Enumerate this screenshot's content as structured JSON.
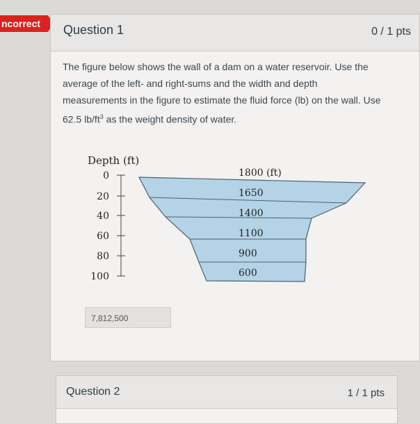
{
  "status_badge": "ncorrect",
  "question1": {
    "title": "Question 1",
    "points": "0 / 1 pts",
    "text_line1": "The figure below shows the wall of a dam on a water reservoir. Use the",
    "text_line2": "average of the left- and right-sums and the width and depth",
    "text_line3": "measurements in the figure to estimate the fluid force (lb) on the wall. Use",
    "text_line4_pre": "62.5 lb/ft",
    "text_line4_sup": "3",
    "text_line4_post": " as the weight density of water.",
    "answer": "7,812,500"
  },
  "figure": {
    "depth_label": "Depth (ft)",
    "depth_ticks": [
      "0",
      "20",
      "40",
      "60",
      "80",
      "100"
    ],
    "width_labels": [
      "1800 (ft)",
      "1650",
      "1400",
      "1100",
      "900",
      "600"
    ],
    "water_fill": "#b5d3e6",
    "water_stroke": "#4a6070"
  },
  "question2": {
    "title": "Question 2",
    "points": "1 / 1 pts"
  }
}
